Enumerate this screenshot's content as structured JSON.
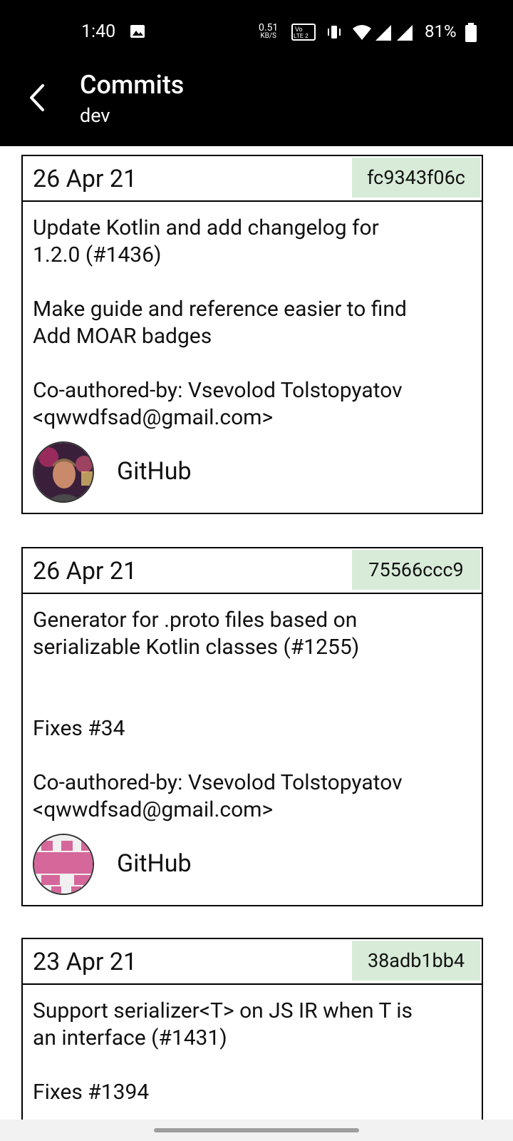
{
  "status_bar": {
    "time": "1:40",
    "net_speed": "0.51",
    "net_unit": "KB/S",
    "volte_top": "Vo",
    "volte_bottom": "LTE 2",
    "battery": "81%",
    "icons": [
      "gallery-icon",
      "vibrate-icon",
      "wifi-icon",
      "signal-icon",
      "signal-icon",
      "battery-icon"
    ]
  },
  "app_bar": {
    "title": "Commits",
    "subtitle": "dev",
    "back_icon": "back-arrow-icon"
  },
  "commits": [
    {
      "date": "26 Apr 21",
      "hash": "fc9343f06c",
      "message_lines": [
        "Update Kotlin and add changelog for",
        "1.2.0 (#1436)",
        "",
        "Make guide and reference easier to find",
        "Add MOAR badges",
        "",
        "Co-authored-by: Vsevolod Tolstopyatov",
        "<qwwdfsad@gmail.com>"
      ],
      "author": "GitHub"
    },
    {
      "date": "26 Apr 21",
      "hash": "75566ccc9",
      "message_lines": [
        "Generator for .proto files based on",
        "serializable Kotlin classes (#1255)",
        "",
        "",
        "Fixes #34",
        "",
        "Co-authored-by: Vsevolod Tolstopyatov",
        "<qwwdfsad@gmail.com>"
      ],
      "author": "GitHub"
    },
    {
      "date": "23 Apr 21",
      "hash": "38adb1bb4",
      "message_lines": [
        "Support serializer<T> on JS IR when T is",
        "an interface (#1431)",
        "",
        "Fixes #1394"
      ],
      "author": ""
    }
  ],
  "colors": {
    "hash_background": "#d8ebd8",
    "bar_background": "#000000"
  }
}
